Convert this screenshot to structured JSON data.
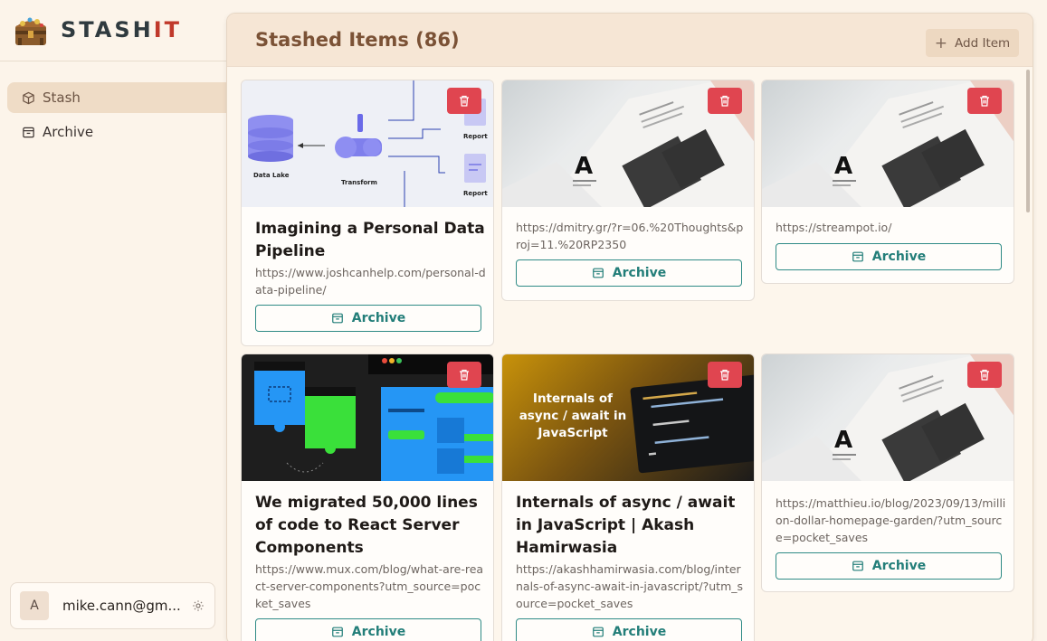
{
  "brand": {
    "name_main": "STASH",
    "name_accent": "IT"
  },
  "sidebar": {
    "items": [
      {
        "label": "Stash",
        "icon": "box-icon",
        "active": true
      },
      {
        "label": "Archive",
        "icon": "archive-icon",
        "active": false
      }
    ]
  },
  "user": {
    "avatar_letter": "A",
    "email": "mike.cann@gm..."
  },
  "main": {
    "title": "Stashed Items (86)",
    "add_button_label": "Add Item"
  },
  "cards": [
    {
      "title": "Imagining a Personal Data Pipeline",
      "url": "https://www.joshcanhelp.com/personal-data-pipeline/",
      "archive_label": "Archive",
      "thumb_labels": {
        "data_lake": "Data Lake",
        "transform": "Transform",
        "report": "Report"
      }
    },
    {
      "title": "",
      "url": "https://dmitry.gr/?r=06.%20Thoughts&proj=11.%20RP2350",
      "archive_label": "Archive"
    },
    {
      "title": "",
      "url": "https://streampot.io/",
      "archive_label": "Archive"
    },
    {
      "title": "We migrated 50,000 lines of code to React Server Components",
      "url": "https://www.mux.com/blog/what-are-react-server-components?utm_source=pocket_saves",
      "archive_label": "Archive"
    },
    {
      "title": "Internals of async / await in JavaScript | Akash Hamirwasia",
      "url": "https://akashhamirwasia.com/blog/internals-of-async-await-in-javascript/?utm_source=pocket_saves",
      "archive_label": "Archive",
      "thumb_text": "Internals of async / await in JavaScript"
    },
    {
      "title": "",
      "url": "https://matthieu.io/blog/2023/09/13/million-dollar-homepage-garden/?utm_source=pocket_saves",
      "archive_label": "Archive"
    }
  ],
  "colors": {
    "accent": "#237e79",
    "delete": "#e04550",
    "title": "#7b5236",
    "background": "#fcf4ea"
  }
}
